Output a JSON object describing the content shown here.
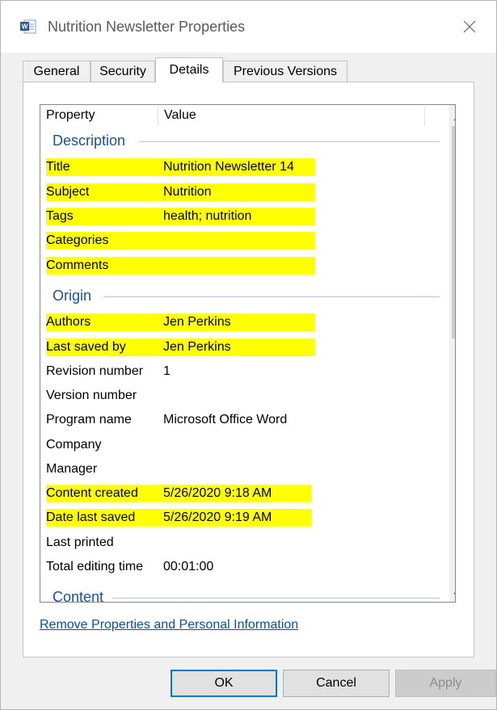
{
  "window": {
    "title": "Nutrition Newsletter Properties",
    "app_icon": "word-document-icon",
    "close_icon": "close-icon"
  },
  "tabs": [
    {
      "label": "General",
      "active": false
    },
    {
      "label": "Security",
      "active": false
    },
    {
      "label": "Details",
      "active": true
    },
    {
      "label": "Previous Versions",
      "active": false
    }
  ],
  "list": {
    "header": {
      "property": "Property",
      "value": "Value"
    },
    "groups": {
      "description": "Description",
      "origin": "Origin",
      "content": "Content"
    },
    "description_rows": [
      {
        "name": "Title",
        "value": "Nutrition Newsletter 14",
        "highlighted": true
      },
      {
        "name": "Subject",
        "value": "Nutrition",
        "highlighted": true
      },
      {
        "name": "Tags",
        "value": "health; nutrition",
        "highlighted": true
      },
      {
        "name": "Categories",
        "value": "",
        "highlighted": true
      },
      {
        "name": "Comments",
        "value": "",
        "highlighted": true
      }
    ],
    "origin_rows": [
      {
        "name": "Authors",
        "value": "Jen Perkins",
        "highlighted": true
      },
      {
        "name": "Last saved by",
        "value": "Jen Perkins",
        "highlighted": true
      },
      {
        "name": "Revision number",
        "value": "1",
        "highlighted": false
      },
      {
        "name": "Version number",
        "value": "",
        "highlighted": false
      },
      {
        "name": "Program name",
        "value": "Microsoft Office Word",
        "highlighted": false
      },
      {
        "name": "Company",
        "value": "",
        "highlighted": false
      },
      {
        "name": "Manager",
        "value": "",
        "highlighted": false
      },
      {
        "name": "Content created",
        "value": "5/26/2020 9:18 AM",
        "highlighted": true
      },
      {
        "name": "Date last saved",
        "value": "5/26/2020 9:19 AM",
        "highlighted": true
      },
      {
        "name": "Last printed",
        "value": "",
        "highlighted": false
      },
      {
        "name": "Total editing time",
        "value": "00:01:00",
        "highlighted": false
      }
    ]
  },
  "scroll": {
    "up": "^",
    "down": "⌄"
  },
  "remove_link": "Remove Properties and Personal Information",
  "buttons": {
    "ok": "OK",
    "cancel": "Cancel",
    "apply": "Apply"
  },
  "colors": {
    "highlight": "#ffff00",
    "group_header": "#1e4e9c",
    "link": "#0a4fa3",
    "focus_border": "#0078d7"
  }
}
